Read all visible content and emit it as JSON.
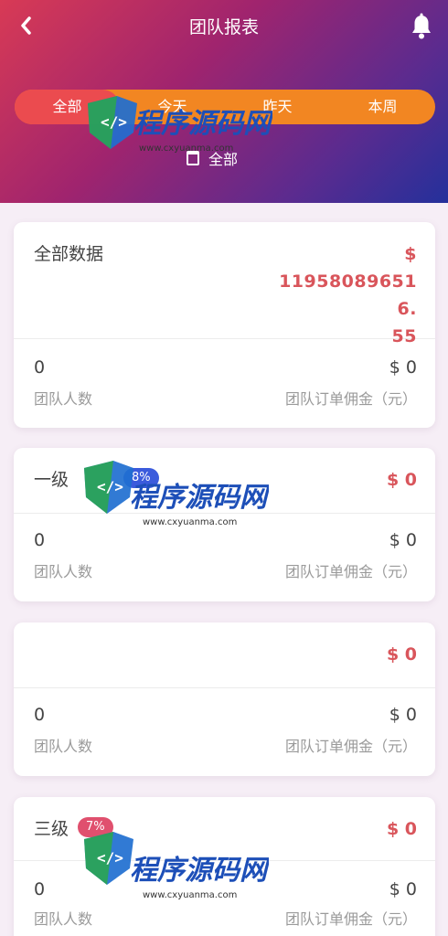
{
  "header": {
    "back_icon": "chevron-left-icon",
    "title": "团队报表",
    "bell_icon": "bell-icon"
  },
  "tabs": [
    {
      "label": "全部",
      "active": true
    },
    {
      "label": "今天",
      "active": false
    },
    {
      "label": "昨天",
      "active": false
    },
    {
      "label": "本周",
      "active": false
    }
  ],
  "selector": {
    "icon": "calendar-icon",
    "label": "全部"
  },
  "cards": [
    {
      "title": "全部数据",
      "badge": "",
      "amount": "$ 11958089 6516.55",
      "amount_text": "$\n119580896516.\n55",
      "members_value": "0",
      "members_label": "团队人数",
      "commission_value": "$ 0",
      "commission_label": "团队订单佣金（元）"
    },
    {
      "title": "一级",
      "badge": "8%",
      "amount": "$ 0",
      "members_value": "0",
      "members_label": "团队人数",
      "commission_value": "$ 0",
      "commission_label": "团队订单佣金（元）"
    },
    {
      "title": "",
      "badge": "",
      "amount": "$ 0",
      "members_value": "0",
      "members_label": "团队人数",
      "commission_value": "$ 0",
      "commission_label": "团队订单佣金（元）"
    },
    {
      "title": "三级",
      "badge": "7%",
      "amount": "$ 0",
      "members_value": "0",
      "members_label": "团队人数",
      "commission_value": "$ 0",
      "commission_label": "团队订单佣金（元）"
    }
  ],
  "watermark": {
    "brand": "程序源码网",
    "url": "www.cxyuanma.com"
  },
  "colors": {
    "tab_bar": "#f28622",
    "tab_active": "#eb4b4f",
    "amount": "#d9555b"
  }
}
